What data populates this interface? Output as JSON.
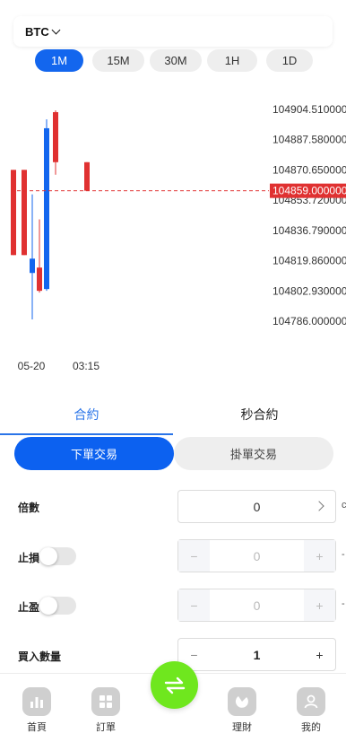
{
  "symbol": {
    "label": "BTC"
  },
  "timeframes": [
    {
      "label": "1M",
      "active": true
    },
    {
      "label": "15M",
      "active": false
    },
    {
      "label": "30M",
      "active": false
    },
    {
      "label": "1H",
      "active": false
    },
    {
      "label": "1D",
      "active": false
    }
  ],
  "chart_data": {
    "type": "candlestick",
    "y_ticks": [
      "104904.5100000",
      "104887.5800000",
      "104870.6500000",
      "104853.7200000",
      "104836.7900000",
      "104819.8600000",
      "104802.9300000",
      "104786.0000000"
    ],
    "ylim": [
      104786.0,
      104904.51
    ],
    "current_price": "104859.0000000",
    "current_price_value": 104859.0,
    "x_ticks": [
      "05-20",
      "03:15"
    ],
    "candles": [
      {
        "open": 104870.7,
        "high": 104870.7,
        "low": 104823.0,
        "close": 104823.0,
        "color": "red"
      },
      {
        "open": 104870.7,
        "high": 104870.7,
        "low": 104823.0,
        "close": 104823.0,
        "color": "red"
      },
      {
        "open": 104821.0,
        "high": 104857.0,
        "low": 104787.0,
        "close": 104813.0,
        "color": "blue"
      },
      {
        "open": 104816.0,
        "high": 104843.0,
        "low": 104802.0,
        "close": 104803.0,
        "color": "red"
      },
      {
        "open": 104804.0,
        "high": 104899.0,
        "low": 104803.0,
        "close": 104894.0,
        "color": "blue"
      },
      {
        "open": 104903.0,
        "high": 104904.0,
        "low": 104868.0,
        "close": 104875.0,
        "color": "red"
      },
      {
        "open": 104875.0,
        "high": 104875.0,
        "low": 104859.0,
        "close": 104859.0,
        "color": "red"
      }
    ],
    "colors": {
      "up": "#1366ee",
      "down": "#e03131",
      "price_line": "#e03131"
    }
  },
  "tabs": {
    "contract": "合約",
    "second_contract": "秒合約"
  },
  "order_type": {
    "market": "下單交易",
    "limit": "掛單交易"
  },
  "leverage": {
    "label": "倍數",
    "value": "0"
  },
  "stop_loss": {
    "label": "止損",
    "value": "0",
    "minus": "−",
    "plus": "+"
  },
  "take_profit": {
    "label": "止盈",
    "value": "0",
    "minus": "−",
    "plus": "+"
  },
  "quantity": {
    "label": "買入數量",
    "value": "1",
    "minus": "−",
    "plus": "+"
  },
  "edge_marks": {
    "leverage": "c",
    "stop_loss": "-",
    "take_profit": "-"
  },
  "nav": {
    "home": "首頁",
    "orders": "訂單",
    "finance": "理財",
    "mine": "我的"
  },
  "accent": "#1366ee",
  "fab_color": "#6fe71e"
}
